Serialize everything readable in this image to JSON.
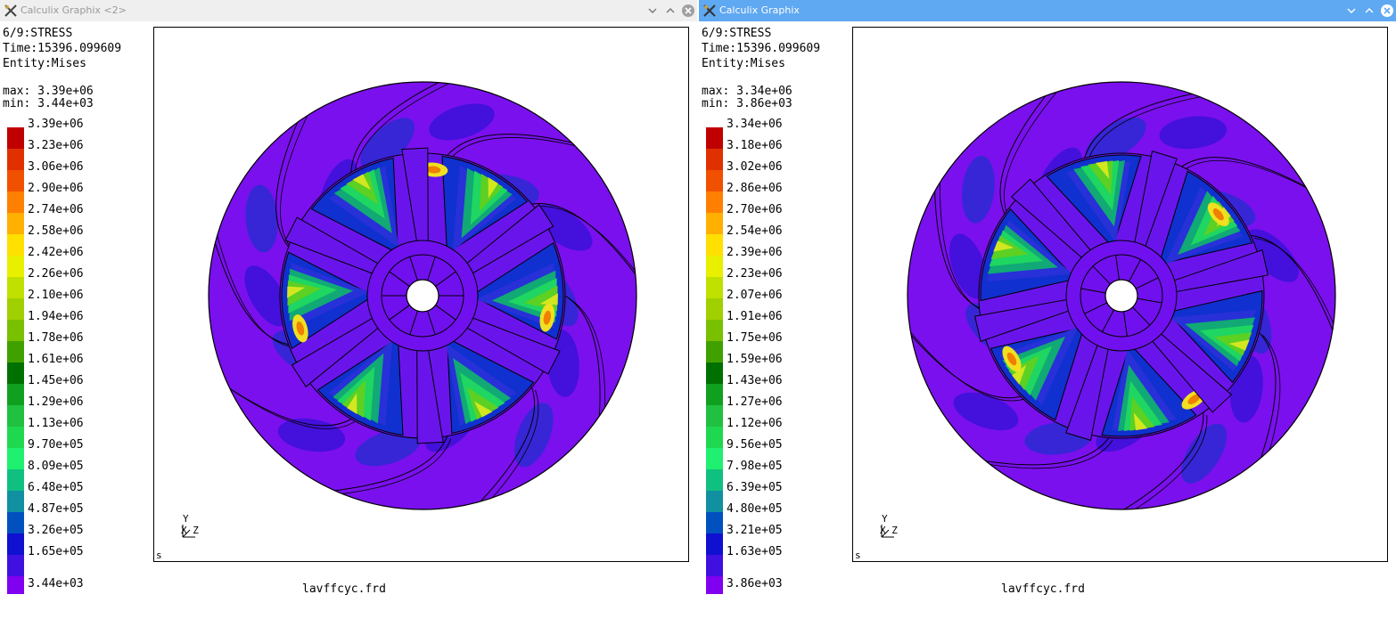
{
  "windows": [
    {
      "id": "left",
      "title": "Calculix Graphix <2>",
      "active": false,
      "header": {
        "step": "6/9:STRESS",
        "time": "Time:15396.099609",
        "entity": "Entity:Mises"
      },
      "max_label": "max: 3.39e+06",
      "min_label": "min: 3.44e+03",
      "legend_labels": [
        "3.39e+06",
        "3.23e+06",
        "3.06e+06",
        "2.90e+06",
        "2.74e+06",
        "2.58e+06",
        "2.42e+06",
        "2.26e+06",
        "2.10e+06",
        "1.94e+06",
        "1.78e+06",
        "1.61e+06",
        "1.45e+06",
        "1.29e+06",
        "1.13e+06",
        "9.70e+05",
        "8.09e+05",
        "6.48e+05",
        "4.87e+05",
        "3.26e+05",
        "1.65e+05",
        "3.44e+03"
      ],
      "hot_angles": [
        -85,
        10,
        165
      ],
      "axis": {
        "y": "Y",
        "xz": "X Z"
      },
      "corner_mark": "s",
      "filename": "lavffcyc.frd"
    },
    {
      "id": "right",
      "title": "Calculix Graphix",
      "active": true,
      "header": {
        "step": "6/9:STRESS",
        "time": "Time:15396.099609",
        "entity": "Entity:Mises"
      },
      "max_label": "max: 3.34e+06",
      "min_label": "min: 3.86e+03",
      "legend_labels": [
        "3.34e+06",
        "3.18e+06",
        "3.02e+06",
        "2.86e+06",
        "2.70e+06",
        "2.54e+06",
        "2.39e+06",
        "2.23e+06",
        "2.07e+06",
        "1.91e+06",
        "1.75e+06",
        "1.59e+06",
        "1.43e+06",
        "1.27e+06",
        "1.12e+06",
        "9.56e+05",
        "7.98e+05",
        "6.39e+05",
        "4.80e+05",
        "3.21e+05",
        "1.63e+05",
        "3.86e+03"
      ],
      "hot_angles": [
        -40,
        55,
        150
      ],
      "axis": {
        "y": "Y",
        "xz": "X Z"
      },
      "corner_mark": "s",
      "filename": "lavffcyc.frd"
    }
  ],
  "colormap": [
    "#c00000",
    "#e03000",
    "#f05000",
    "#ff8000",
    "#ffb000",
    "#ffe000",
    "#e8f000",
    "#c0e000",
    "#a0d000",
    "#78c000",
    "#40a000",
    "#007000",
    "#10a020",
    "#20c040",
    "#20d850",
    "#20f070",
    "#10c080",
    "#1090a0",
    "#0050c0",
    "#1010d0",
    "#4010e0",
    "#8000f0"
  ],
  "colors": {
    "active_titlebar": "#5fa8f2",
    "inactive_titlebar": "#efefef",
    "background": "#ffffff"
  },
  "icons": [
    "app-icon",
    "minimize-icon",
    "maximize-icon",
    "close-icon"
  ]
}
